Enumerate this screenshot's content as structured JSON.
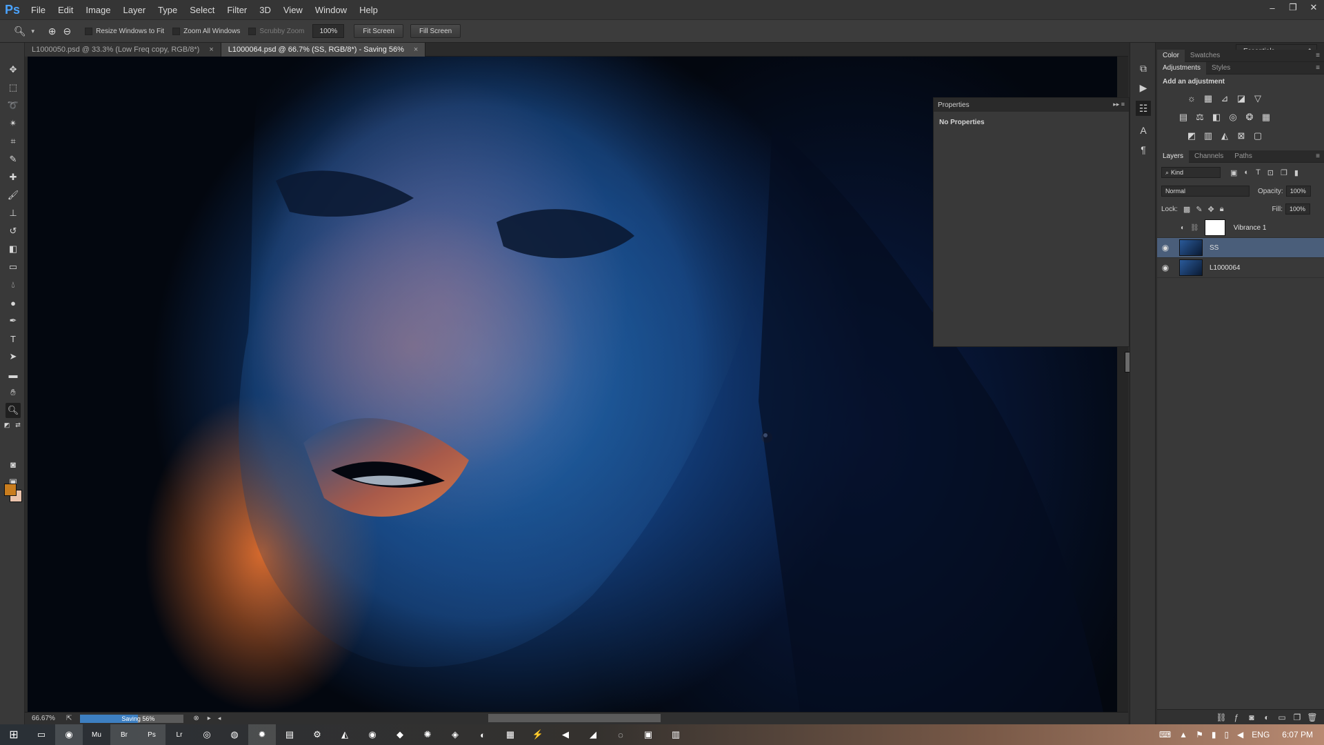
{
  "app": {
    "logo": "Ps"
  },
  "menu": [
    "File",
    "Edit",
    "Image",
    "Layer",
    "Type",
    "Select",
    "Filter",
    "3D",
    "View",
    "Window",
    "Help"
  ],
  "window_controls": {
    "minimize": "–",
    "restore": "❐",
    "close": "✕"
  },
  "options_bar": {
    "tool_icon": "zoom-icon",
    "resize_windows_to_fit": {
      "label": "Resize Windows to Fit",
      "checked": false
    },
    "zoom_all_windows": {
      "label": "Zoom All Windows",
      "checked": false
    },
    "scrubby_zoom": {
      "label": "Scrubby Zoom",
      "checked": false,
      "disabled": true
    },
    "zoom_percent": "100%",
    "fit_screen": "Fit Screen",
    "fill_screen": "Fill Screen",
    "workspace": "Essentials"
  },
  "doc_tabs": [
    {
      "title": "L1000050.psd @ 33.3% (Low Freq copy, RGB/8*)",
      "active": false
    },
    {
      "title": "L1000064.psd @ 66.7% (SS, RGB/8*) - Saving 56%",
      "active": true
    }
  ],
  "properties_panel": {
    "title": "Properties",
    "body": "No Properties"
  },
  "status_bar": {
    "zoom": "66.67%",
    "progress_label": "Saving 56%",
    "progress": 0.56
  },
  "color_panel": {
    "tabs": [
      "Color",
      "Swatches"
    ],
    "active": "Color"
  },
  "adjustments_panel": {
    "tabs": [
      "Adjustments",
      "Styles"
    ],
    "active": "Adjustments",
    "title": "Add an adjustment"
  },
  "layers_panel": {
    "tabs": [
      "Layers",
      "Channels",
      "Paths"
    ],
    "active": "Layers",
    "kind": "Kind",
    "blend_mode": "Normal",
    "opacity_label": "Opacity:",
    "opacity": "100%",
    "lock_label": "Lock:",
    "fill_label": "Fill:",
    "fill": "100%",
    "layers": [
      {
        "name": "Vibrance 1",
        "visible": false,
        "selected": false
      },
      {
        "name": "SS",
        "visible": true,
        "selected": true
      },
      {
        "name": "L1000064",
        "visible": true,
        "selected": false
      }
    ]
  },
  "colors": {
    "foreground": "#c97d1e",
    "background": "#eac3ac",
    "accent": "#3d7fc1"
  },
  "taskbar": {
    "language": "ENG",
    "time": "6:07 PM"
  }
}
